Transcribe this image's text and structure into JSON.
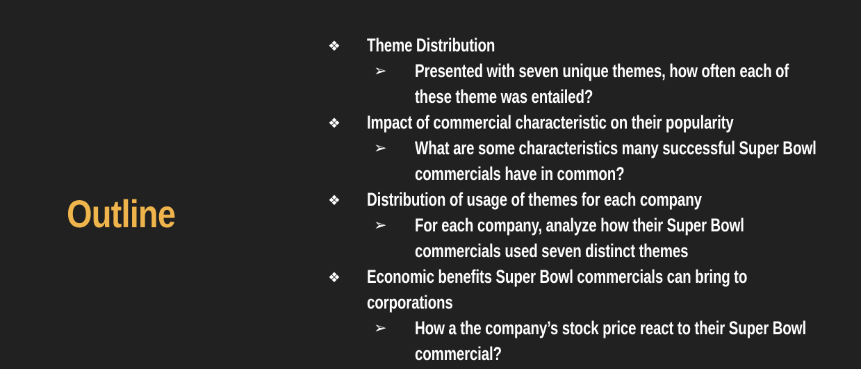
{
  "slide": {
    "title": "Outline",
    "colors": {
      "background": "#212121",
      "title": "#efb44b",
      "text": "#ffffff"
    },
    "bullet_icons": {
      "level1": "diamond-bullet-icon",
      "level2": "arrowhead-bullet-icon"
    },
    "symbols": {
      "diamond": "❖",
      "arrow": "➢"
    },
    "items": [
      {
        "lines": [
          "Theme Distribution"
        ],
        "sub": {
          "lines": [
            "Presented with seven unique themes, how often each of",
            "these theme was entailed?"
          ]
        }
      },
      {
        "lines": [
          "Impact of commercial characteristic on their popularity"
        ],
        "sub": {
          "lines": [
            "What are some characteristics many successful Super Bowl",
            "commercials have in common?"
          ]
        }
      },
      {
        "lines": [
          "Distribution of usage of themes for each company"
        ],
        "sub": {
          "lines": [
            "For each company, analyze how their Super Bowl",
            "commercials used seven distinct themes"
          ]
        }
      },
      {
        "lines": [
          "Economic benefits Super Bowl commercials can bring to",
          "corporations"
        ],
        "sub": {
          "lines": [
            "How a the company’s stock price react to their Super Bowl",
            "commercial?"
          ]
        }
      }
    ]
  }
}
